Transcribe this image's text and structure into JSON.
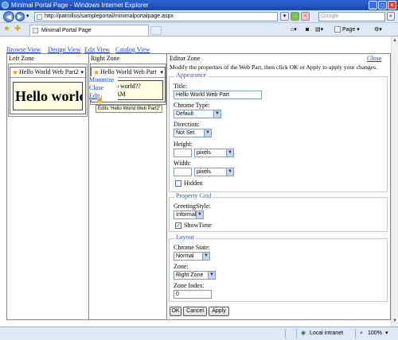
{
  "window": {
    "title": "Minimal Portal Page - Windows Internet Explorer"
  },
  "address": {
    "url": "http://patrollus/sampleportal/minimalportalpage.aspx"
  },
  "search": {
    "placeholder": "Google"
  },
  "tab": {
    "label": "Minimal Portal Page"
  },
  "toolbar": {
    "page_label": "Page ▾"
  },
  "nav_links": [
    "Browse View",
    "Design View",
    "Edit View",
    "Catalog View"
  ],
  "left_zone": {
    "header": "Left Zone",
    "part_title": "Hello World Web Part2",
    "part_body": "Hello world!"
  },
  "right_zone": {
    "header": "Right Zone",
    "part_title": "Hello World Web Part",
    "part_body_line1": "p world??",
    "part_body_line2": "AM",
    "verbs": [
      "Minimize",
      "Close",
      "Edit"
    ],
    "tooltip": "Edits 'Hello World Web Part2'"
  },
  "editor": {
    "header": "Editor Zone",
    "close_label": "Close",
    "instructions": "Modify the properties of the Web Part, then click OK or Apply to apply your changes.",
    "appearance": {
      "legend": "Appearance",
      "title_label": "Title:",
      "title_value": "Hello World Web Part",
      "chrome_type_label": "Chrome Type:",
      "chrome_type_value": "Default",
      "direction_label": "Direction:",
      "direction_value": "Not Set",
      "height_label": "Height:",
      "height_unit": "pixels",
      "width_label": "Width:",
      "width_unit": "pixels",
      "hidden_label": "Hidden"
    },
    "property_grid": {
      "legend": "Property Grid",
      "greeting_label": "GreetingStyle:",
      "greeting_value": "Informal",
      "showtime_label": "ShowTime"
    },
    "layout": {
      "legend": "Layout",
      "chrome_state_label": "Chrome State:",
      "chrome_state_value": "Normal",
      "zone_label": "Zone:",
      "zone_value": "Right Zone",
      "zone_index_label": "Zone Index:",
      "zone_index_value": "0"
    },
    "buttons": {
      "ok": "OK",
      "cancel": "Cancel",
      "apply": "Apply"
    }
  },
  "status": {
    "zone": "Local intranet",
    "zoom": "100%"
  }
}
